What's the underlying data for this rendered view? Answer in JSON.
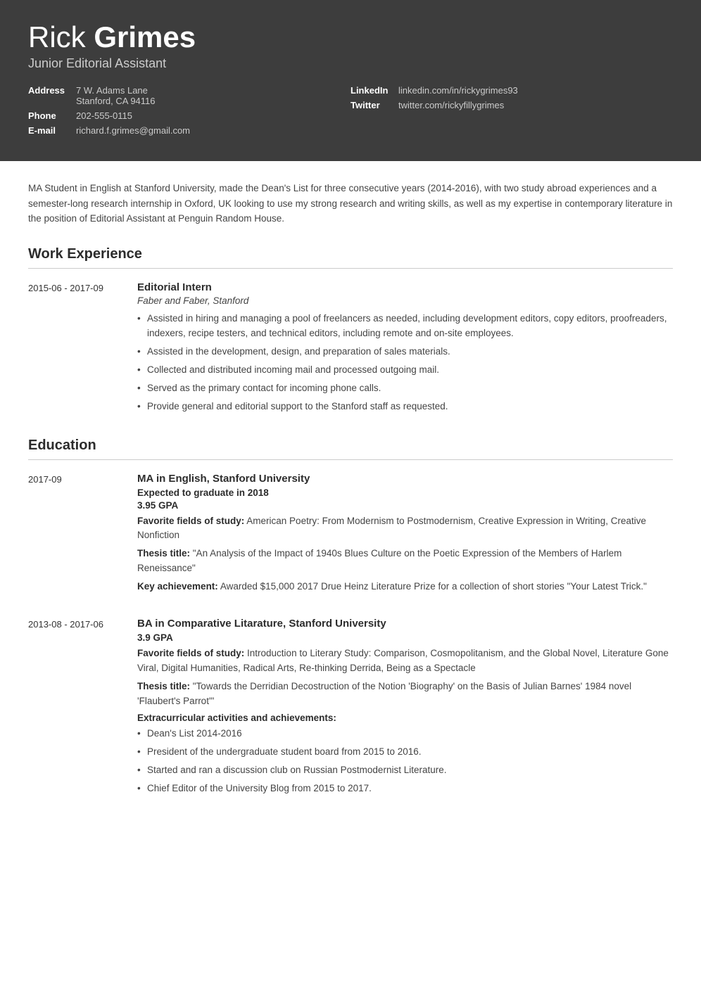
{
  "header": {
    "first_name": "Rick ",
    "last_name": "Grimes",
    "title": "Junior Editorial Assistant",
    "address_label": "Address",
    "address_line1": "7 W. Adams Lane",
    "address_line2": "Stanford, CA 94116",
    "phone_label": "Phone",
    "phone": "202-555-0115",
    "email_label": "E-mail",
    "email": "richard.f.grimes@gmail.com",
    "linkedin_label": "LinkedIn",
    "linkedin": "linkedin.com/in/rickygrimes93",
    "twitter_label": "Twitter",
    "twitter": "twitter.com/rickyfillygrimes"
  },
  "summary": "MA Student in English at Stanford University, made the Dean's List for three consecutive years (2014-2016), with two study abroad experiences and a semester-long research internship in Oxford, UK looking to use my strong research and writing skills, as well as my expertise in contemporary literature in the position of Editorial Assistant at Penguin Random House.",
  "work_experience": {
    "section_title": "Work Experience",
    "entries": [
      {
        "date": "2015-06 - 2017-09",
        "title": "Editorial Intern",
        "company": "Faber and Faber, Stanford",
        "bullets": [
          "Assisted in hiring and managing a pool of freelancers as needed, including development editors, copy editors, proofreaders, indexers, recipe testers, and technical editors, including remote and on-site employees.",
          "Assisted in the development, design, and preparation of sales materials.",
          "Collected and distributed incoming mail and processed outgoing mail.",
          "Served as the primary contact for incoming phone calls.",
          "Provide general and editorial support to the Stanford staff as requested."
        ]
      }
    ]
  },
  "education": {
    "section_title": "Education",
    "entries": [
      {
        "date": "2017-09",
        "title": "MA in English, Stanford University",
        "expected": "Expected to graduate in 2018",
        "gpa": "3.95 GPA",
        "favorite_label": "Favorite fields of study:",
        "favorite_value": " American Poetry: From Modernism to Postmodernism, Creative Expression in Writing, Creative Nonfiction",
        "thesis_label": "Thesis title:",
        "thesis_value": " \"An Analysis of the Impact of 1940s Blues Culture on the Poetic Expression of the Members of Harlem Reneissance\"",
        "achievement_label": "Key achievement:",
        "achievement_value": " Awarded $15,000 2017 Drue Heinz Literature Prize for a collection of short stories \"Your Latest Trick.\""
      },
      {
        "date": "2013-08 - 2017-06",
        "title": "BA in Comparative Litarature, Stanford University",
        "gpa": "3.9 GPA",
        "favorite_label": "Favorite fields of study:",
        "favorite_value": " Introduction to Literary Study: Comparison, Cosmopolitanism, and the Global Novel, Literature Gone Viral, Digital Humanities, Radical Arts, Re-thinking Derrida, Being as a Spectacle",
        "thesis_label": "Thesis title:",
        "thesis_value": " \"Towards the Derridian Decostruction of the Notion 'Biography' on the Basis of Julian Barnes' 1984 novel 'Flaubert's Parrot'\"",
        "extracurricular_label": "Extracurricular activities and achievements:",
        "extracurricular_bullets": [
          "Dean's List 2014-2016",
          "President of the undergraduate student board from 2015 to 2016.",
          "Started and ran a discussion club on Russian Postmodernist Literature.",
          "Chief Editor of the University Blog from 2015 to 2017."
        ]
      }
    ]
  }
}
